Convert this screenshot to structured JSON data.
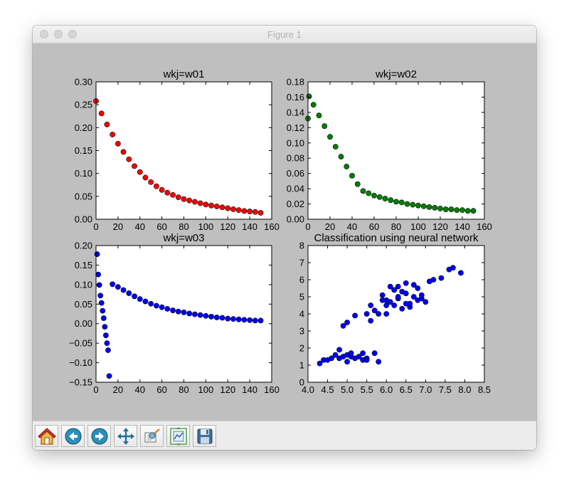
{
  "window": {
    "title": "Figure 1"
  },
  "toolbar": {
    "buttons": [
      {
        "icon": "home-icon"
      },
      {
        "icon": "back-arrow-icon"
      },
      {
        "icon": "forward-arrow-icon"
      },
      {
        "icon": "pan-move-icon"
      },
      {
        "icon": "zoom-rect-icon"
      },
      {
        "icon": "subplot-config-icon"
      },
      {
        "icon": "save-floppy-icon"
      }
    ]
  },
  "chart_data": [
    {
      "type": "scatter",
      "title": "wkj=w01",
      "xlim": [
        0,
        160
      ],
      "ylim": [
        0,
        0.3
      ],
      "xticks": [
        0,
        20,
        40,
        60,
        80,
        100,
        120,
        140,
        160
      ],
      "yticks": [
        0.0,
        0.05,
        0.1,
        0.15,
        0.2,
        0.25,
        0.3
      ],
      "xtick_labels": [
        "0",
        "20",
        "40",
        "60",
        "80",
        "100",
        "120",
        "140",
        "160"
      ],
      "ytick_labels": [
        "0.00",
        "0.05",
        "0.10",
        "0.15",
        "0.20",
        "0.25",
        "0.30"
      ],
      "color": "#ff0000",
      "x": [
        0,
        5,
        10,
        15,
        20,
        25,
        30,
        35,
        40,
        45,
        50,
        55,
        60,
        65,
        70,
        75,
        80,
        85,
        90,
        95,
        100,
        105,
        110,
        115,
        120,
        125,
        130,
        135,
        140,
        145,
        150
      ],
      "y": [
        0.258,
        0.231,
        0.207,
        0.185,
        0.165,
        0.147,
        0.131,
        0.116,
        0.103,
        0.091,
        0.081,
        0.072,
        0.064,
        0.058,
        0.053,
        0.048,
        0.044,
        0.041,
        0.038,
        0.035,
        0.032,
        0.03,
        0.028,
        0.026,
        0.024,
        0.022,
        0.02,
        0.018,
        0.017,
        0.016,
        0.014
      ]
    },
    {
      "type": "scatter",
      "title": "wkj=w02",
      "xlim": [
        0,
        160
      ],
      "ylim": [
        0,
        0.18
      ],
      "xticks": [
        0,
        20,
        40,
        60,
        80,
        100,
        120,
        140,
        160
      ],
      "yticks": [
        0.0,
        0.02,
        0.04,
        0.06,
        0.08,
        0.1,
        0.12,
        0.14,
        0.16,
        0.18
      ],
      "xtick_labels": [
        "0",
        "20",
        "40",
        "60",
        "80",
        "100",
        "120",
        "140",
        "160"
      ],
      "ytick_labels": [
        "0.00",
        "0.02",
        "0.04",
        "0.06",
        "0.08",
        "0.10",
        "0.12",
        "0.14",
        "0.16",
        "0.18"
      ],
      "color": "#008000",
      "x": [
        0,
        1,
        5,
        10,
        15,
        20,
        25,
        30,
        35,
        40,
        45,
        50,
        55,
        60,
        65,
        70,
        75,
        80,
        85,
        90,
        95,
        100,
        105,
        110,
        115,
        120,
        125,
        130,
        135,
        140,
        145,
        150
      ],
      "y": [
        0.132,
        0.161,
        0.15,
        0.136,
        0.122,
        0.108,
        0.095,
        0.082,
        0.069,
        0.057,
        0.046,
        0.037,
        0.034,
        0.031,
        0.029,
        0.027,
        0.025,
        0.023,
        0.022,
        0.02,
        0.019,
        0.018,
        0.017,
        0.016,
        0.015,
        0.014,
        0.013,
        0.013,
        0.012,
        0.012,
        0.011,
        0.011
      ]
    },
    {
      "type": "scatter",
      "title": "wkj=w03",
      "xlim": [
        0,
        160
      ],
      "ylim": [
        -0.15,
        0.2
      ],
      "xticks": [
        0,
        20,
        40,
        60,
        80,
        100,
        120,
        140,
        160
      ],
      "yticks": [
        -0.15,
        -0.1,
        -0.05,
        0.0,
        0.05,
        0.1,
        0.15,
        0.2
      ],
      "xtick_labels": [
        "0",
        "20",
        "40",
        "60",
        "80",
        "100",
        "120",
        "140",
        "160"
      ],
      "ytick_labels": [
        "−0.15",
        "−0.10",
        "−0.05",
        "0.00",
        "0.05",
        "0.10",
        "0.15",
        "0.20"
      ],
      "color": "#0000ff",
      "x": [
        1,
        2,
        3,
        4,
        5,
        6,
        7,
        8,
        9,
        10,
        11,
        12,
        15,
        20,
        25,
        30,
        35,
        40,
        45,
        50,
        55,
        60,
        65,
        70,
        75,
        80,
        85,
        90,
        95,
        100,
        105,
        110,
        115,
        120,
        125,
        130,
        135,
        140,
        145,
        150
      ],
      "y": [
        0.178,
        0.126,
        0.099,
        0.072,
        0.053,
        0.033,
        0.014,
        -0.008,
        -0.03,
        -0.05,
        -0.068,
        -0.134,
        0.101,
        0.094,
        0.086,
        0.078,
        0.07,
        0.063,
        0.057,
        0.051,
        0.046,
        0.042,
        0.038,
        0.034,
        0.031,
        0.029,
        0.026,
        0.024,
        0.022,
        0.02,
        0.018,
        0.016,
        0.015,
        0.013,
        0.012,
        0.011,
        0.01,
        0.009,
        0.008,
        0.008
      ]
    },
    {
      "type": "scatter",
      "title": "Classification using neural network",
      "xlim": [
        4.0,
        8.5
      ],
      "ylim": [
        0,
        8
      ],
      "xticks": [
        4.0,
        4.5,
        5.0,
        5.5,
        6.0,
        6.5,
        7.0,
        7.5,
        8.0,
        8.5
      ],
      "yticks": [
        0,
        1,
        2,
        3,
        4,
        5,
        6,
        7,
        8
      ],
      "xtick_labels": [
        "4.0",
        "4.5",
        "5.0",
        "5.5",
        "6.0",
        "6.5",
        "7.0",
        "7.5",
        "8.0",
        "8.5"
      ],
      "ytick_labels": [
        "0",
        "1",
        "2",
        "3",
        "4",
        "5",
        "6",
        "7",
        "8"
      ],
      "color": "#0000ff",
      "x": [
        4.3,
        4.4,
        4.5,
        4.6,
        4.7,
        4.8,
        4.8,
        4.9,
        5.0,
        5.0,
        5.1,
        5.1,
        5.2,
        5.3,
        5.4,
        5.4,
        5.5,
        5.5,
        5.7,
        5.8,
        4.9,
        5.0,
        5.2,
        5.5,
        5.6,
        5.7,
        5.8,
        5.9,
        6.0,
        6.0,
        6.1,
        6.2,
        6.3,
        6.4,
        6.5,
        6.6,
        6.7,
        6.8,
        6.9,
        7.0,
        5.6,
        5.9,
        6.1,
        6.3,
        6.5,
        6.7,
        6.9,
        7.2,
        7.4,
        7.6,
        7.7,
        7.9,
        6.2,
        6.4,
        6.6,
        6.8,
        7.1,
        6.0,
        6.3,
        6.5
      ],
      "y": [
        1.1,
        1.3,
        1.3,
        1.4,
        1.6,
        1.4,
        1.9,
        1.5,
        1.2,
        1.6,
        1.5,
        1.7,
        1.4,
        1.5,
        1.3,
        1.7,
        1.4,
        1.3,
        1.7,
        1.2,
        3.3,
        3.5,
        3.9,
        4.0,
        3.6,
        4.2,
        4.0,
        4.8,
        4.0,
        4.5,
        4.7,
        4.5,
        4.9,
        4.3,
        4.6,
        4.4,
        5.0,
        4.8,
        4.9,
        4.7,
        4.5,
        5.1,
        5.6,
        5.6,
        5.8,
        5.7,
        5.1,
        6.0,
        6.1,
        6.6,
        6.7,
        6.4,
        5.4,
        5.3,
        4.6,
        5.5,
        5.9,
        4.8,
        5.0,
        5.2
      ]
    }
  ]
}
